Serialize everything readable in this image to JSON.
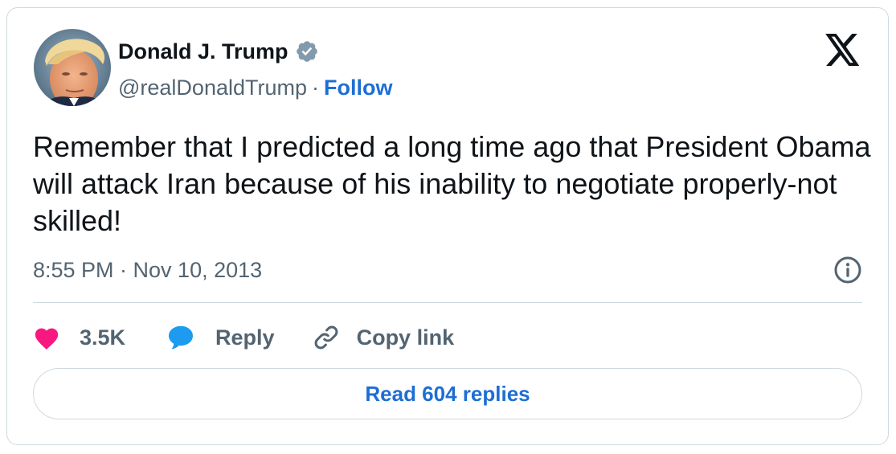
{
  "author": {
    "name": "Donald J. Trump",
    "handle": "@realDonaldTrump",
    "separator": "·",
    "follow_label": "Follow",
    "verified_icon": "verified-badge-icon",
    "avatar": "profile-photo"
  },
  "brand": {
    "logo": "x-logo-icon"
  },
  "tweet": {
    "text": "Remember that I predicted a long time ago that President Obama will attack Iran because of his inability to negotiate properly-not skilled!",
    "timestamp": "8:55 PM · Nov 10, 2013"
  },
  "actions": {
    "like_count": "3.5K",
    "reply_label": "Reply",
    "copy_link_label": "Copy link"
  },
  "read_replies_label": "Read 604 replies",
  "colors": {
    "accent_blue": "#1d6ed4",
    "like_pink": "#f91880",
    "reply_blue": "#1d9bf0",
    "verified_gray": "#829aab",
    "muted_text": "#536471",
    "border": "#cfd9de"
  }
}
